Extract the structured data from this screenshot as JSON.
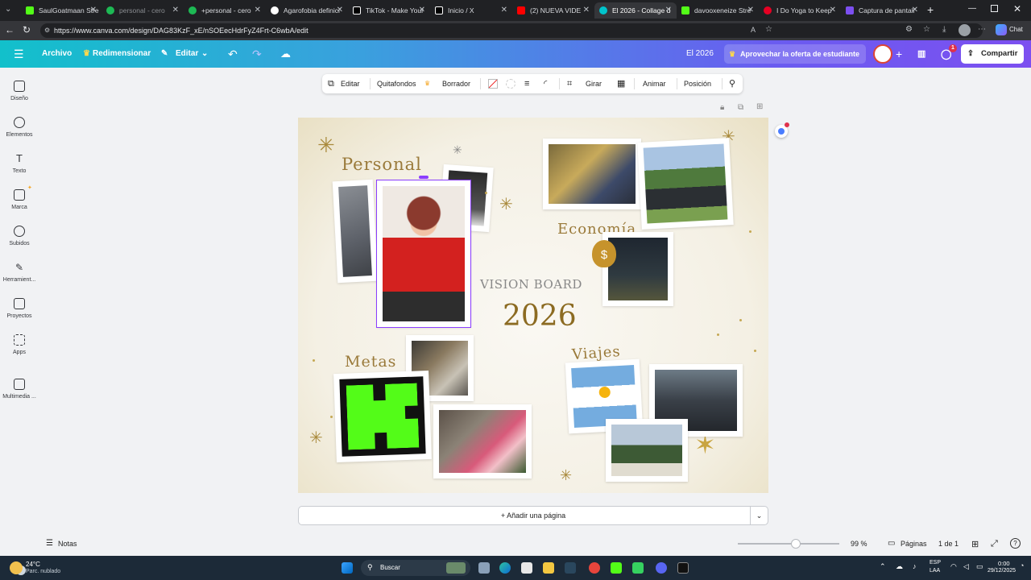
{
  "browser": {
    "tabs": [
      {
        "title": "SaulGoatmaan Stre",
        "color": "#53fc18"
      },
      {
        "title": "personal - cero",
        "color": "#1db954"
      },
      {
        "title": "+personal - cero",
        "color": "#1db954"
      },
      {
        "title": "Agarofobia definici",
        "color": "#ffffff"
      },
      {
        "title": "TikTok - Make Your",
        "color": "#ffffff"
      },
      {
        "title": "Inicio / X",
        "color": "#ffffff"
      },
      {
        "title": "(2) NUEVA VIDE",
        "color": "#ff0000"
      },
      {
        "title": "El 2026 - Collage d",
        "color": "#00c4cc"
      },
      {
        "title": "davooxeneize Stre",
        "color": "#53fc18"
      },
      {
        "title": "I Do Yoga to Keep",
        "color": "#e60023"
      },
      {
        "title": "Captura de pantall",
        "color": "#7c4ff0"
      }
    ],
    "url": "https://www.canva.com/design/DAG83KzF_xE/nSOEecHdrFyZ4Frt-C6wbA/edit",
    "chat_label": "Chat"
  },
  "header": {
    "archivo": "Archivo",
    "redimensionar": "Redimensionar",
    "editar": "Editar",
    "doc_title": "El 2026",
    "offer": "Aprovechar la oferta de estudiante",
    "share": "Compartir",
    "notif_count": "1"
  },
  "rail": [
    {
      "label": "Diseño",
      "icon": "layout-icon"
    },
    {
      "label": "Elementos",
      "icon": "shapes-icon"
    },
    {
      "label": "Texto",
      "icon": "text-icon"
    },
    {
      "label": "Marca",
      "icon": "brand-icon"
    },
    {
      "label": "Subidos",
      "icon": "cloud-upload-icon"
    },
    {
      "label": "Herramient...",
      "icon": "pen-icon"
    },
    {
      "label": "Proyectos",
      "icon": "folder-icon"
    },
    {
      "label": "Apps",
      "icon": "apps-icon"
    },
    {
      "label": "Multimedia ...",
      "icon": "media-icon"
    }
  ],
  "toolbar": {
    "editar": "Editar",
    "quitafondos": "Quitafondos",
    "borrador": "Borrador",
    "girar": "Girar",
    "animar": "Animar",
    "posicion": "Posición"
  },
  "design": {
    "personal": "Personal",
    "economia": "Economía",
    "vision_board": "VISION BOARD",
    "year": "2026",
    "metas": "Metas",
    "viajes": "Viajes"
  },
  "bottom": {
    "add_page": "+ Añadir una página",
    "notas": "Notas",
    "zoom": "99 %",
    "paginas": "Páginas",
    "page_count": "1 de 1"
  },
  "taskbar": {
    "temp": "24°C",
    "weather": "Parc. nublado",
    "search": "Buscar",
    "lang1": "ESP",
    "lang2": "LAA",
    "time": "0:00",
    "date": "29/12/2025"
  }
}
